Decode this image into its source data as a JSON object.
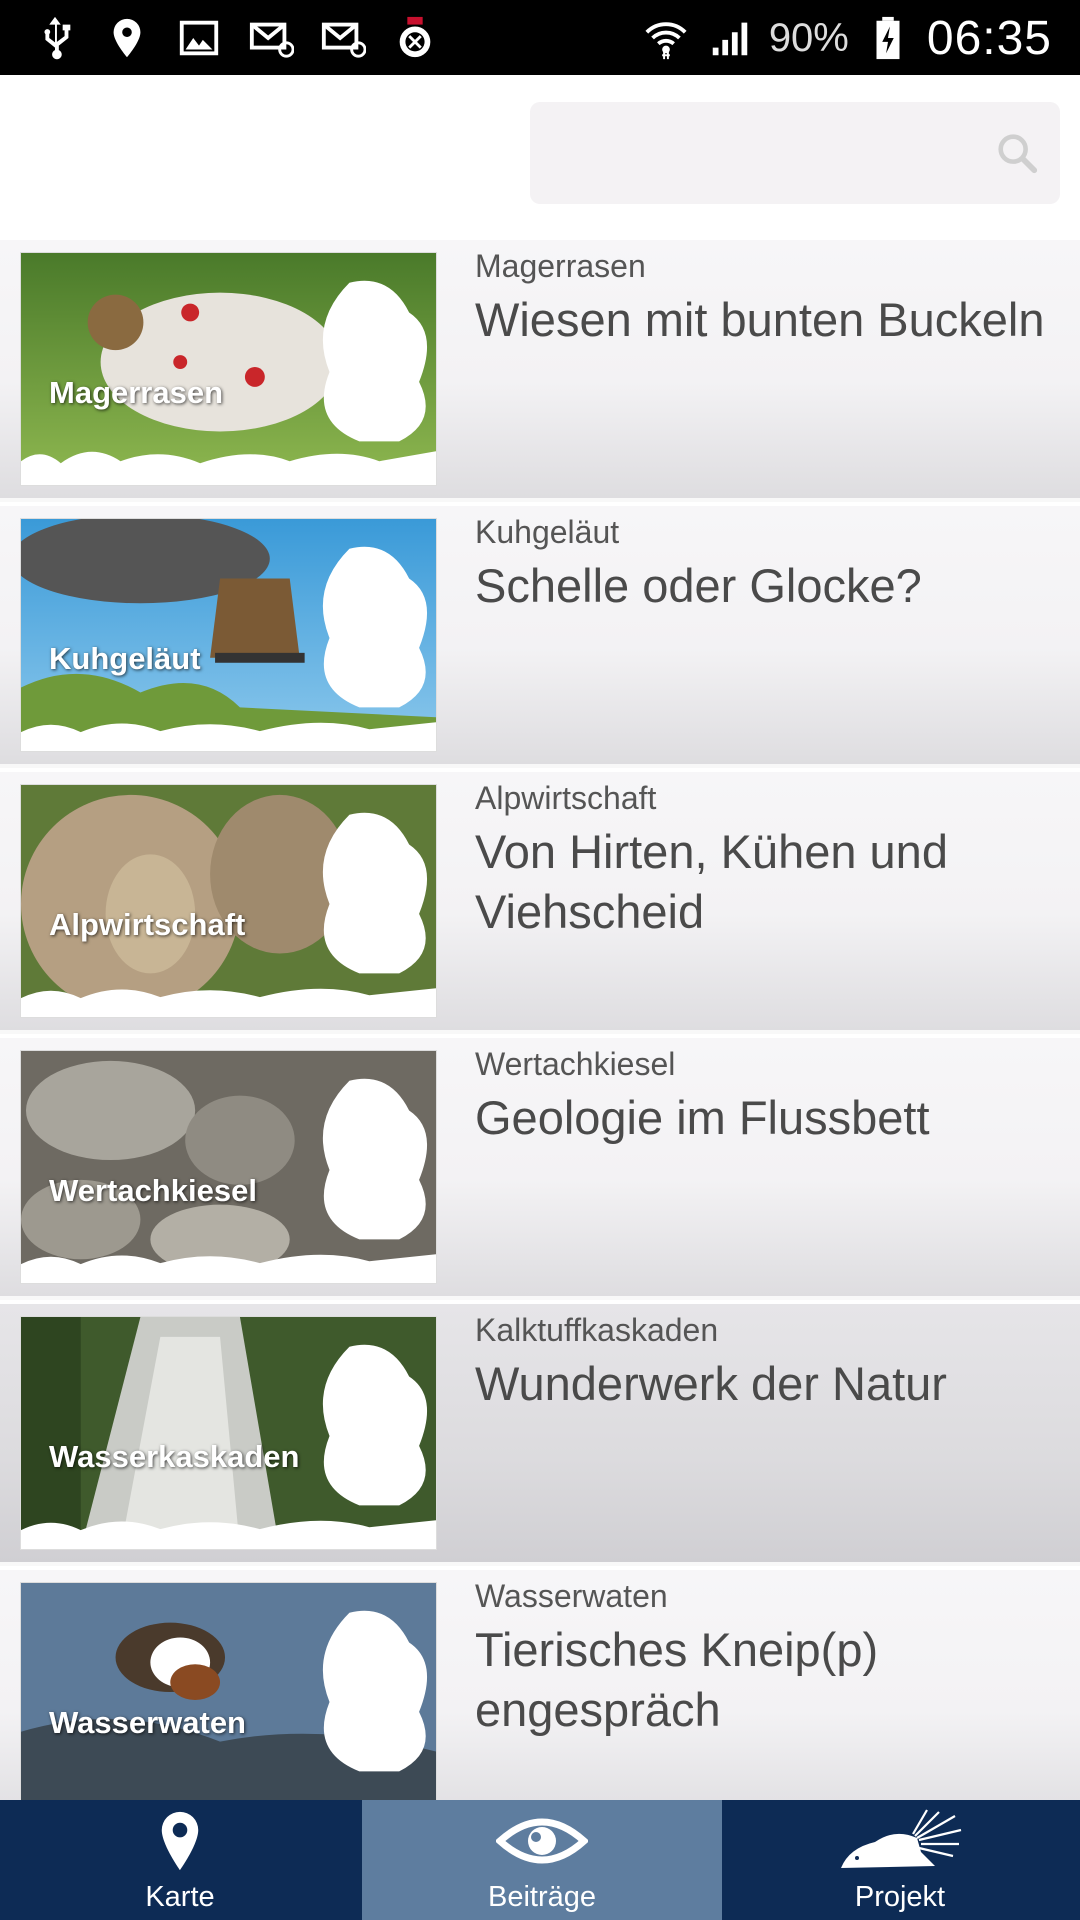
{
  "status_bar": {
    "left_icons": [
      "usb-icon",
      "location-pin-icon",
      "image-icon",
      "email-icon",
      "email-icon",
      "marvel-app-icon"
    ],
    "battery_percent": "90%",
    "time": "06:35"
  },
  "search": {
    "placeholder": ""
  },
  "items": [
    {
      "image_label": "Magerrasen",
      "category": "Magerrasen",
      "title": "Wiesen mit bunten Buckeln"
    },
    {
      "image_label": "Kuhgeläut",
      "category": "Kuhgeläut",
      "title": "Schelle oder Glocke?"
    },
    {
      "image_label": "Alpwirtschaft",
      "category": "Alpwirtschaft",
      "title": "Von Hirten, Kühen und Viehscheid"
    },
    {
      "image_label": "Wertachkiesel",
      "category": "Wertachkiesel",
      "title": "Geologie im Flussbett"
    },
    {
      "image_label": "Wasserkaskaden",
      "category": "Kalktuffkaskaden",
      "title": "Wunderwerk der Natur"
    },
    {
      "image_label": "Wasserwaten",
      "category": "Wasserwaten",
      "title": "Tierisches Kneip(p) engespräch"
    }
  ],
  "nav": [
    {
      "label": "Karte",
      "icon": "map-pin-icon"
    },
    {
      "label": "Beiträge",
      "icon": "eye-icon",
      "active": true
    },
    {
      "label": "Projekt",
      "icon": "hedgehog-icon"
    }
  ],
  "colors": {
    "nav_bg": "#0d2b55",
    "nav_active_bg": "#5e7d9f",
    "status_bar_bg": "#000000"
  }
}
